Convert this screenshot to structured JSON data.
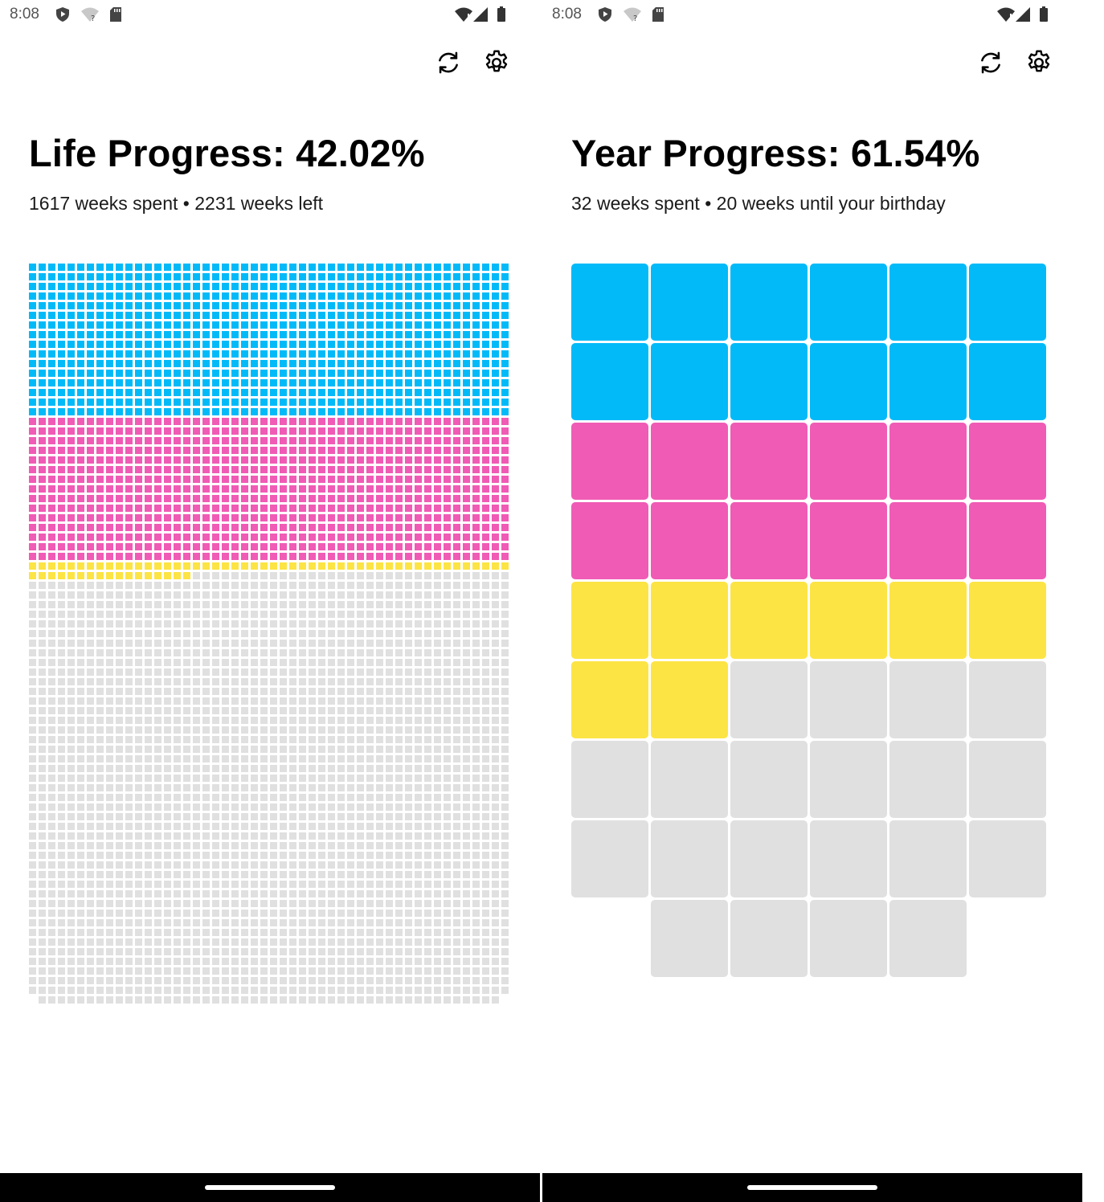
{
  "colors": {
    "cyan": "#02BAF8",
    "magenta": "#F05BB5",
    "yellow": "#FCE444",
    "empty": "#E0E0E0",
    "navbar": "#000000"
  },
  "icons": {
    "status": [
      "shield-icon",
      "wifi-unknown-icon",
      "sd-card-icon",
      "wifi-icon",
      "signal-icon",
      "battery-icon"
    ],
    "top": [
      "refresh-icon",
      "settings-gear-icon"
    ]
  },
  "left": {
    "status_time": "8:08",
    "title": "Life Progress: 42.02%",
    "subtitle": "1617 weeks spent • 2231 weeks left",
    "grid": {
      "columns": 50,
      "total_cells": 3848,
      "segments": [
        {
          "color": "cyan",
          "count": 800
        },
        {
          "color": "magenta",
          "count": 750
        },
        {
          "color": "yellow",
          "count": 67
        },
        {
          "color": "empty",
          "count": 2231
        }
      ]
    }
  },
  "right": {
    "status_time": "8:08",
    "title": "Year Progress: 61.54%",
    "subtitle": "32 weeks spent • 20 weeks until your birthday",
    "grid": {
      "columns": 6,
      "total_cells": 52,
      "segments": [
        {
          "color": "cyan",
          "count": 12
        },
        {
          "color": "magenta",
          "count": 12
        },
        {
          "color": "yellow",
          "count": 8
        },
        {
          "color": "empty",
          "count": 20
        }
      ]
    }
  }
}
